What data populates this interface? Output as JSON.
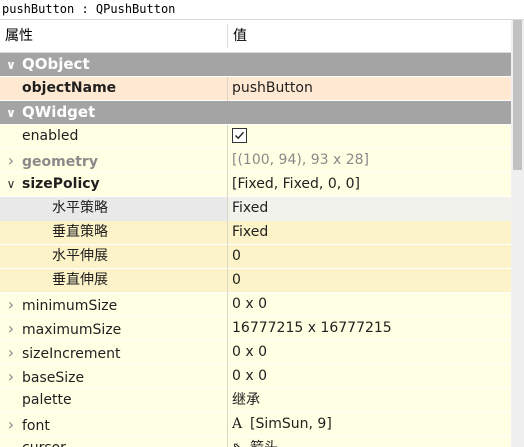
{
  "title": "pushButton : QPushButton",
  "header": {
    "col_property": "属性",
    "col_value": "值"
  },
  "rows": [
    {
      "type": "section",
      "name": "QObject"
    },
    {
      "type": "prop",
      "name": "objectName",
      "value": "pushButton",
      "bold": true,
      "bg": "peach"
    },
    {
      "type": "section",
      "name": "QWidget"
    },
    {
      "type": "prop",
      "name": "enabled",
      "checkbox": true,
      "checked": true,
      "bg": "light-y"
    },
    {
      "type": "prop",
      "name": "geometry",
      "value": "[(100, 94), 93 x 28]",
      "expander": "collapsed",
      "bold": true,
      "disabled": true,
      "bg": "light-y"
    },
    {
      "type": "prop",
      "name": "sizePolicy",
      "value": "[Fixed, Fixed, 0, 0]",
      "expander": "expanded",
      "bold": true,
      "bg": "light-y"
    },
    {
      "type": "sub",
      "name": "水平策略",
      "value": "Fixed",
      "selected": true
    },
    {
      "type": "sub",
      "name": "垂直策略",
      "value": "Fixed",
      "bg": "dark-y"
    },
    {
      "type": "sub",
      "name": "水平伸展",
      "value": "0",
      "bg": "dark-y"
    },
    {
      "type": "sub",
      "name": "垂直伸展",
      "value": "0",
      "bg": "dark-y"
    },
    {
      "type": "prop",
      "name": "minimumSize",
      "value": "0 x 0",
      "expander": "collapsed",
      "bg": "light-y"
    },
    {
      "type": "prop",
      "name": "maximumSize",
      "value": "16777215 x 16777215",
      "expander": "collapsed",
      "bg": "light-y"
    },
    {
      "type": "prop",
      "name": "sizeIncrement",
      "value": "0 x 0",
      "expander": "collapsed",
      "bg": "light-y"
    },
    {
      "type": "prop",
      "name": "baseSize",
      "value": "0 x 0",
      "expander": "collapsed",
      "bg": "light-y"
    },
    {
      "type": "prop",
      "name": "palette",
      "value": "继承",
      "bg": "light-y"
    },
    {
      "type": "prop",
      "name": "font",
      "value": "[SimSun, 9]",
      "icon": "font-glyph-icon",
      "icon_glyph": "A",
      "expander": "collapsed",
      "bg": "light-y"
    },
    {
      "type": "prop",
      "name": "cursor",
      "value": "箭头",
      "icon": "arrow-cursor-icon",
      "icon_glyph": "⇖",
      "bg": "light-y"
    }
  ],
  "colors": {
    "section_bg": "#a4a4a4",
    "row_light": "#ffffe4",
    "row_dark": "#fdf3c8",
    "highlight": "#ffe9d2"
  }
}
